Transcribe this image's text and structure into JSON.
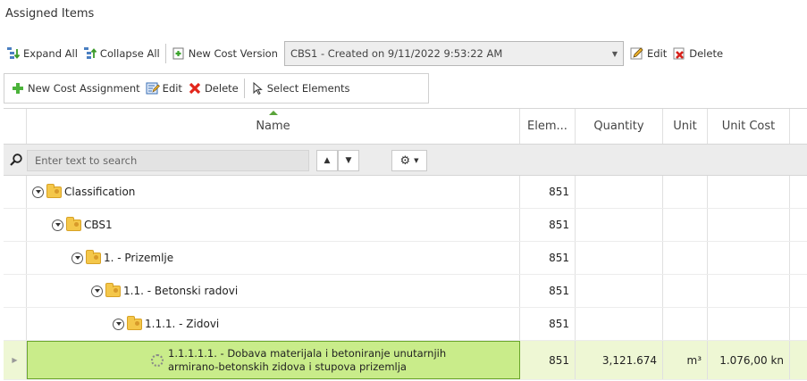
{
  "panel": {
    "title": "Assigned Items"
  },
  "toolbar1": {
    "expand_all": "Expand All",
    "collapse_all": "Collapse All",
    "new_cost_version": "New Cost Version",
    "cost_version_selected": "CBS1 - Created on 9/11/2022 9:53:22 AM",
    "edit": "Edit",
    "delete": "Delete"
  },
  "toolbar2": {
    "new_cost_assignment": "New Cost Assignment",
    "edit": "Edit",
    "delete": "Delete",
    "select_elements": "Select Elements"
  },
  "columns": {
    "name": "Name",
    "elements": "Elem...",
    "quantity": "Quantity",
    "unit": "Unit",
    "unit_cost": "Unit Cost"
  },
  "search": {
    "placeholder": "Enter text to search"
  },
  "rows": [
    {
      "label": "Classification",
      "elements": "851",
      "quantity": "",
      "unit": "",
      "unit_cost": ""
    },
    {
      "label": "CBS1",
      "elements": "851",
      "quantity": "",
      "unit": "",
      "unit_cost": ""
    },
    {
      "label": "1. - Prizemlje",
      "elements": "851",
      "quantity": "",
      "unit": "",
      "unit_cost": ""
    },
    {
      "label": "1.1. - Betonski radovi",
      "elements": "851",
      "quantity": "",
      "unit": "",
      "unit_cost": ""
    },
    {
      "label": "1.1.1. - Zidovi",
      "elements": "851",
      "quantity": "",
      "unit": "",
      "unit_cost": ""
    }
  ],
  "selected_row": {
    "label_line1": "1.1.1.1.1. - Dobava materijala i betoniranje unutarnjih",
    "label_line2": "armirano-betonskih zidova i stupova prizemlja",
    "elements": "851",
    "quantity": "3,121.674",
    "unit": "m³",
    "unit_cost": "1.076,00 kn"
  },
  "colors": {
    "selection_fill": "#c9ec8a",
    "selection_border": "#6aa52a",
    "folder": "#f4c74a"
  }
}
